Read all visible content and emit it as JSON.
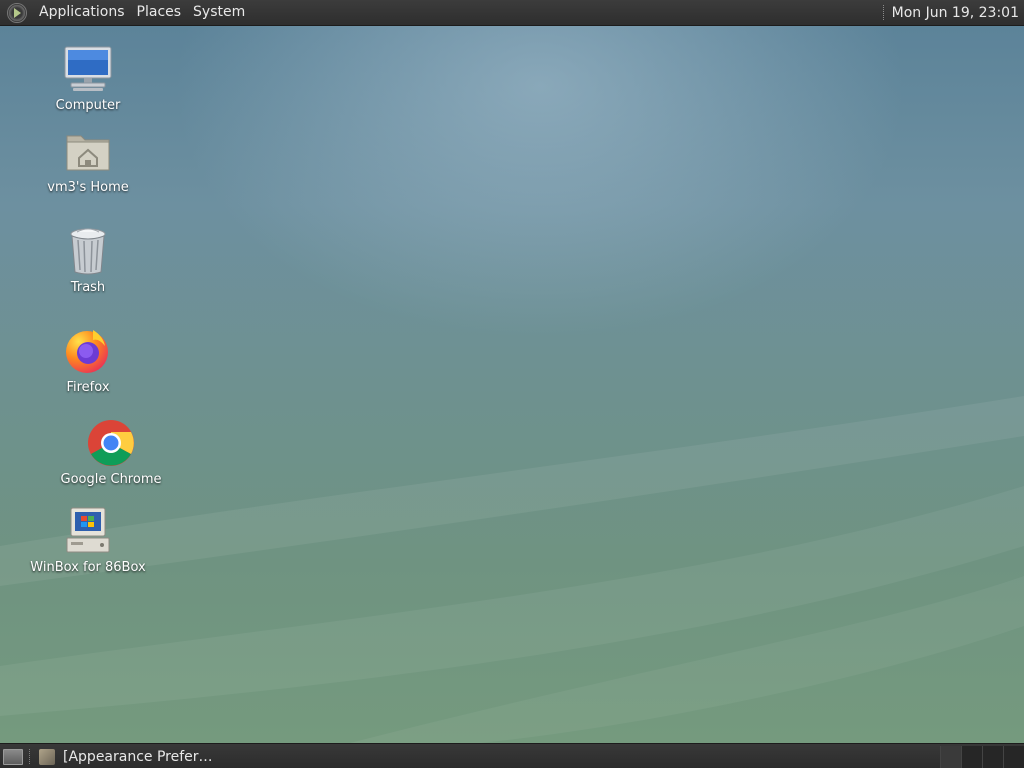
{
  "top_panel": {
    "menus": [
      "Applications",
      "Places",
      "System"
    ],
    "clock": "Mon Jun 19, 23:01"
  },
  "desktop": {
    "icons": [
      {
        "label": "Computer",
        "icon": "computer-icon"
      },
      {
        "label": "vm3's Home",
        "icon": "home-folder-icon"
      },
      {
        "label": "Trash",
        "icon": "trash-icon"
      },
      {
        "label": "Firefox",
        "icon": "firefox-icon"
      },
      {
        "label": "Google Chrome",
        "icon": "chrome-icon"
      },
      {
        "label": "WinBox for 86Box",
        "icon": "winbox-icon"
      }
    ]
  },
  "bottom_panel": {
    "task_label": "[Appearance Prefer…",
    "workspace_count": 4
  },
  "colors": {
    "panel_bg": "#333333",
    "desktop_top": "#5c8399",
    "desktop_bottom": "#759a7e"
  }
}
